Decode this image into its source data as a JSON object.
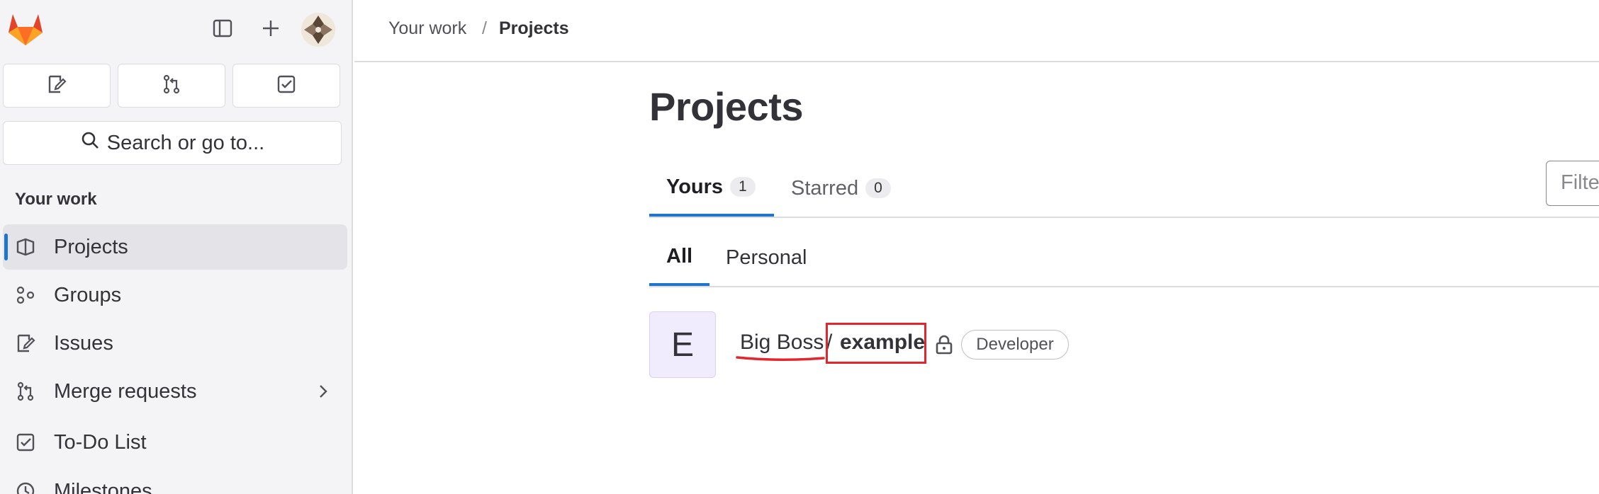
{
  "sidebar": {
    "logo_icon": "gitlab-tanuki-logo",
    "toggle_icon": "sidebar-toggle-icon",
    "new_icon": "plus-icon",
    "avatar_icon": "user-avatar",
    "quick_buttons": [
      {
        "icon": "issues-icon"
      },
      {
        "icon": "merge-request-icon"
      },
      {
        "icon": "todo-icon"
      }
    ],
    "search_label": "Search or go to...",
    "section_title": "Your work",
    "items": [
      {
        "label": "Projects",
        "icon": "project-icon",
        "active": true
      },
      {
        "label": "Groups",
        "icon": "group-icon"
      },
      {
        "label": "Issues",
        "icon": "issues-icon"
      },
      {
        "label": "Merge requests",
        "icon": "merge-request-icon",
        "has_chevron": true
      },
      {
        "label": "To-Do List",
        "icon": "todo-icon"
      },
      {
        "label": "Milestones",
        "icon": "clock-icon"
      }
    ]
  },
  "breadcrumb": {
    "items": [
      "Your work",
      "Projects"
    ],
    "separator": "/"
  },
  "main": {
    "title": "Projects",
    "tabs": [
      {
        "label": "Yours",
        "count": "1",
        "active": true
      },
      {
        "label": "Starred",
        "count": "0"
      }
    ],
    "filter_placeholder": "Filter by name",
    "subtabs": [
      {
        "label": "All",
        "active": true
      },
      {
        "label": "Personal"
      }
    ],
    "project": {
      "avatar_letter": "E",
      "namespace": "Big Boss",
      "separator": "/",
      "name": "example",
      "visibility_icon": "lock-icon",
      "role": "Developer"
    }
  },
  "colors": {
    "accent": "#1f75cb",
    "highlight_box": "#e3262d",
    "sidebar_bg": "#f4f4f6",
    "avatar_bg": "#f1ecfd"
  }
}
